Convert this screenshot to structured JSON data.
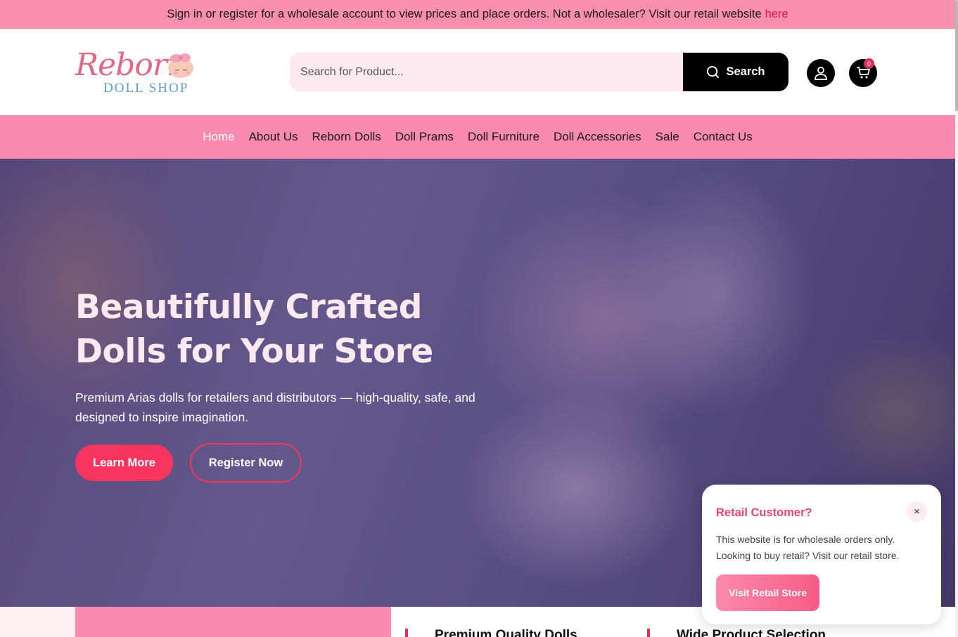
{
  "topbar": {
    "message": "Sign in or register for a wholesale account to view prices and place orders. Not a wholesaler? Visit our retail website",
    "link_label": "here"
  },
  "header": {
    "logo_main": "Reborn",
    "logo_sub": "DOLL SHOP",
    "search": {
      "placeholder": "Search for Product...",
      "value": "",
      "button_label": "Search"
    },
    "cart_count": "0",
    "icons": [
      "search-icon",
      "user-icon",
      "cart-icon"
    ]
  },
  "nav": {
    "items": [
      {
        "label": "Home",
        "active": true
      },
      {
        "label": "About Us"
      },
      {
        "label": "Reborn Dolls"
      },
      {
        "label": "Doll Prams"
      },
      {
        "label": "Doll Furniture"
      },
      {
        "label": "Doll Accessories"
      },
      {
        "label": "Sale"
      },
      {
        "label": "Contact Us"
      }
    ]
  },
  "hero": {
    "title_line1": "Beautifully Crafted",
    "title_line2": "Dolls for Your Store",
    "description": "Premium Arias dolls for retailers and distributors — high-quality, safe, and designed to inspire imagination.",
    "learn_more": "Learn More",
    "register_now": "Register Now"
  },
  "features": {
    "item1": "Premium Quality Dolls",
    "item2": "Wide Product Selection"
  },
  "popup": {
    "title": "Retail Customer?",
    "close": "×",
    "text_line1": "This website is for wholesale orders only.",
    "text_line2": "Looking to buy retail? Visit our retail store.",
    "button": "Visit Retail Store"
  },
  "colors": {
    "topbar_bg": "#f98fb0",
    "nav_bg": "#fb8ab0",
    "accent": "#f7355f",
    "link": "#e0144e"
  }
}
